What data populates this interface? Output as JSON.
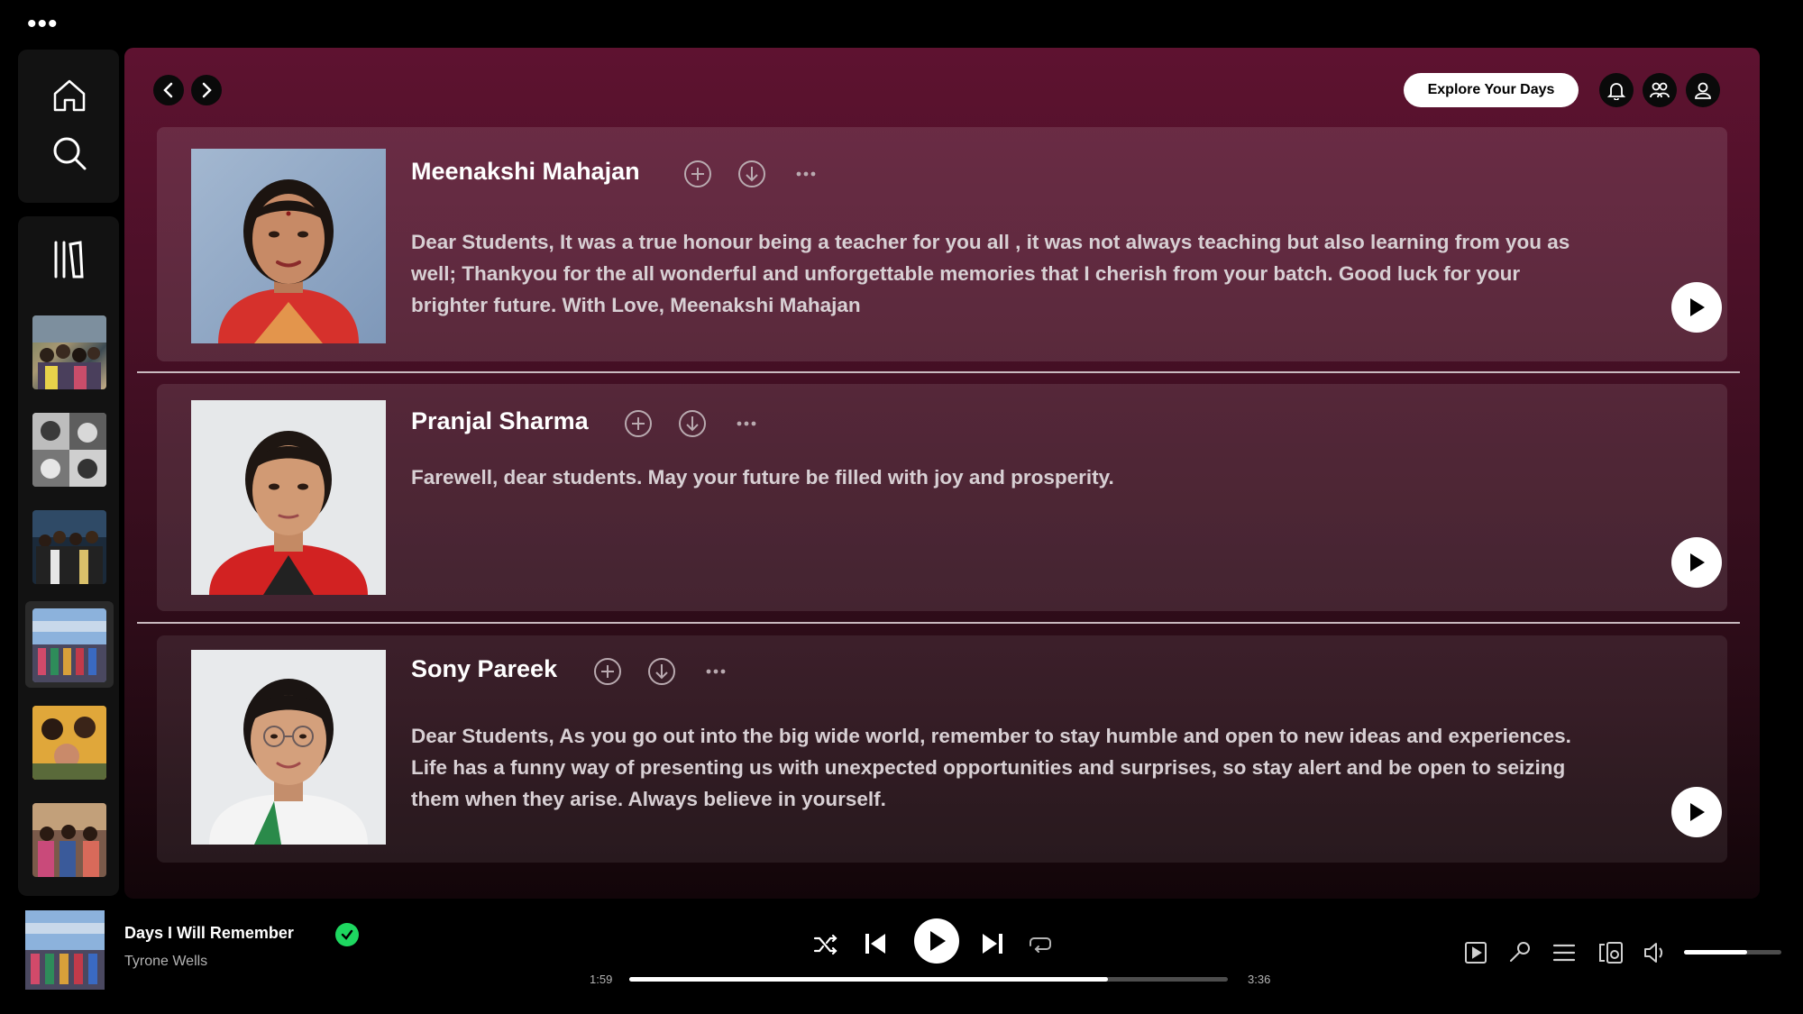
{
  "top_menu_label": "•••",
  "header": {
    "explore_button": "Explore Your Days"
  },
  "cards": [
    {
      "name": "Meenakshi Mahajan",
      "message": "Dear Students, It was a true honour being a teacher for you all , it was not always teaching but also learning from you as well; Thankyou for the all wonderful and unforgettable memories that I cherish from your batch. Good luck for your brighter future. With Love, Meenakshi Mahajan"
    },
    {
      "name": "Pranjal Sharma",
      "message": "Farewell, dear students. May your future be filled with joy and prosperity."
    },
    {
      "name": "Sony Pareek",
      "message": "Dear Students, As you go out into the big wide world, remember to stay humble and open to new ideas and experiences. Life has a funny way of presenting us with unexpected opportunities and surprises, so stay alert and be open to seizing them when they arise. Always believe in yourself."
    }
  ],
  "player": {
    "track_title": "Days I Will Remember",
    "artist": "Tyrone Wells",
    "elapsed": "1:59",
    "duration": "3:36",
    "progress_fraction": 0.8,
    "volume_fraction": 0.65,
    "liked": true
  },
  "colors": {
    "accent_green": "#1ed760",
    "main_gradient_top": "#5e1230",
    "card_background": "rgba(255,255,255,0.09)"
  },
  "icons": {
    "sidebar": [
      "home-icon",
      "search-icon",
      "library-icon"
    ],
    "card_actions": [
      "add-circle-icon",
      "download-icon",
      "more-icon",
      "play-icon"
    ],
    "header": [
      "back-arrow-icon",
      "forward-arrow-icon",
      "bell-icon",
      "friends-icon",
      "user-icon"
    ],
    "player": [
      "shuffle-icon",
      "previous-icon",
      "play-icon",
      "next-icon",
      "repeat-icon",
      "now-playing-view-icon",
      "lyrics-icon",
      "queue-icon",
      "connect-device-icon",
      "volume-icon"
    ]
  }
}
